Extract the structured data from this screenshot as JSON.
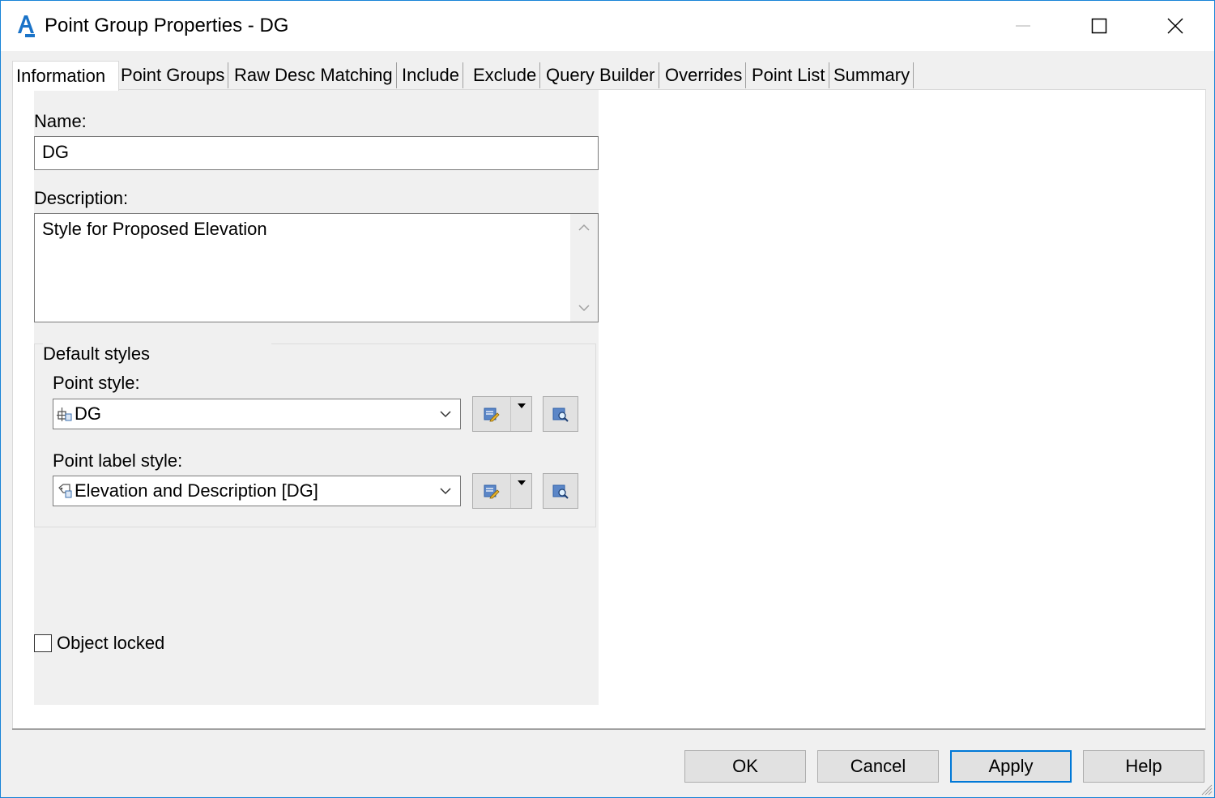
{
  "window": {
    "title": "Point Group Properties - DG",
    "icon": "autocad-civil3d-icon"
  },
  "tabs": [
    {
      "label": "Information",
      "active": true
    },
    {
      "label": "Point Groups"
    },
    {
      "label": "Raw Desc Matching"
    },
    {
      "label": "Include"
    },
    {
      "label": "Exclude"
    },
    {
      "label": "Query Builder"
    },
    {
      "label": "Overrides"
    },
    {
      "label": "Point List"
    },
    {
      "label": "Summary"
    }
  ],
  "information": {
    "name_label": "Name:",
    "name_value": "DG",
    "description_label": "Description:",
    "description_value": "Style for Proposed Elevation",
    "default_styles_title": "Default styles",
    "point_style_label": "Point style:",
    "point_style_value": "DG",
    "point_label_style_label": "Point label style:",
    "point_label_style_value": "Elevation and Description [DG]",
    "object_locked_label": "Object locked",
    "object_locked_checked": false
  },
  "buttons": {
    "ok": "OK",
    "cancel": "Cancel",
    "apply": "Apply",
    "help": "Help"
  },
  "colors": {
    "accent": "#0078d7",
    "window_border": "#1883d7",
    "dialog_bg": "#f0f0f0"
  }
}
